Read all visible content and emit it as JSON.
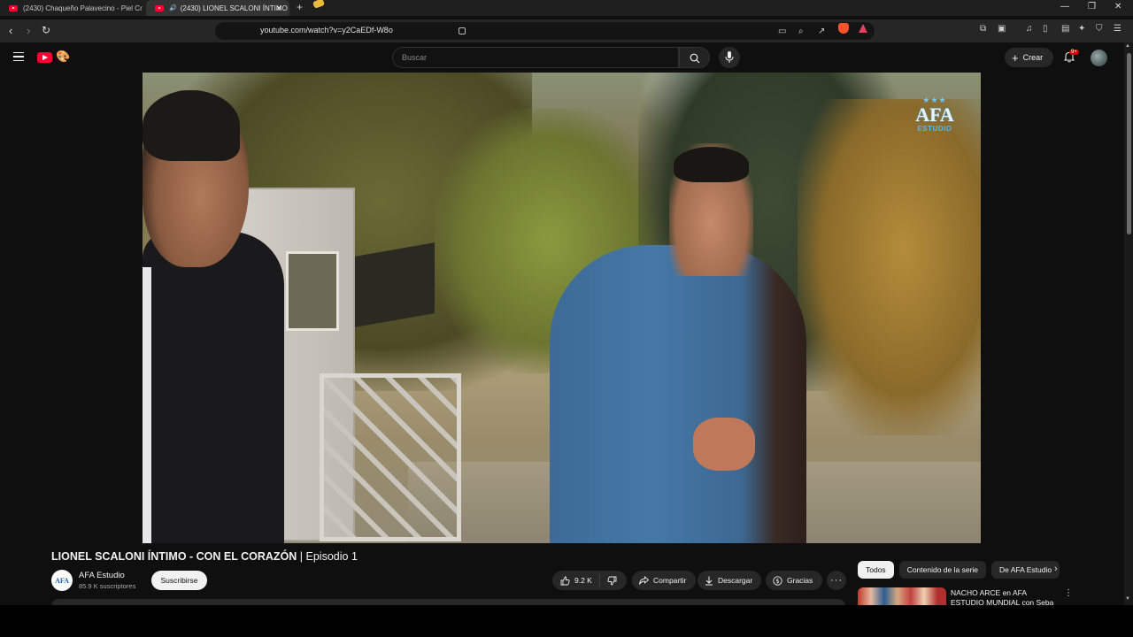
{
  "browser": {
    "tabs": [
      {
        "title": "(2430) Chaqueño Palavecino - Piel Cr",
        "active": false
      },
      {
        "title": "(2430) LIONEL SCALONI ÍNTIMO",
        "active": true
      }
    ],
    "url": "youtube.com/watch?v=y2CaEDf-W8o",
    "icons": [
      "back-icon",
      "forward-icon",
      "reload-icon",
      "bookmark-icon",
      "new-tab-icon",
      "minimize-icon",
      "restore-icon",
      "close-icon"
    ]
  },
  "header": {
    "search_placeholder": "Buscar",
    "create_label": "Crear",
    "notification_badge": "9+"
  },
  "video": {
    "watermark": {
      "stars": "★★★",
      "title": "AFA",
      "subtitle": "ESTUDIO"
    }
  },
  "title": {
    "main": "LIONEL SCALONI ÍNTIMO - CON EL CORAZÓN",
    "episode": " | Episodio 1"
  },
  "channel": {
    "name": "AFA Estudio",
    "subscribers": "85.9 K suscriptores",
    "subscribe_label": "Suscribirse",
    "avatar_text": "AFA"
  },
  "actions": {
    "likes": "9.2 K",
    "share": "Compartir",
    "download": "Descargar",
    "thanks": "Gracias"
  },
  "chips": [
    {
      "label": "Todos",
      "active": true
    },
    {
      "label": "Contenido de la serie",
      "active": false
    },
    {
      "label": "De AFA Estudio",
      "active": false
    }
  ],
  "recommendation": {
    "title_prefix": "NACHO ARCE",
    "title_connector": " en ",
    "title_rest": "AFA ESTUDIO MUNDIAL con Seba Varela"
  },
  "colors": {
    "background": "#0f0f0f",
    "youtube_red": "#ff0033",
    "chip_active": "#f1f1f1",
    "button_bg": "#272727"
  }
}
